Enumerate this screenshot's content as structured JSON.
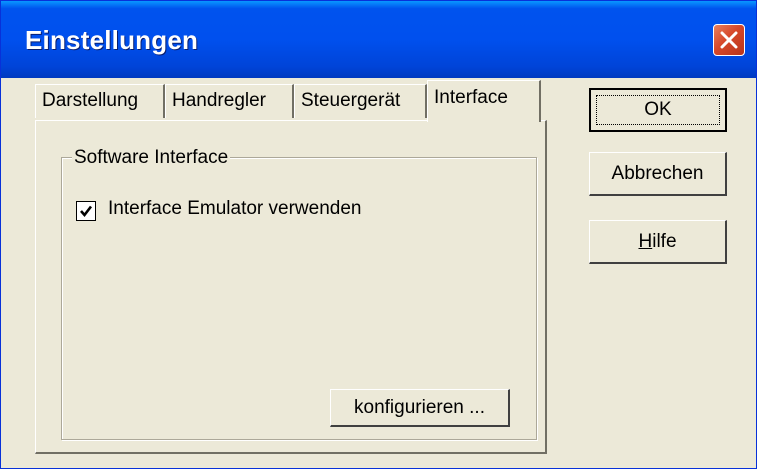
{
  "window": {
    "title": "Einstellungen"
  },
  "tabs": [
    {
      "label": "Darstellung"
    },
    {
      "label": "Handregler"
    },
    {
      "label": "Steuergerät"
    },
    {
      "label": "Interface",
      "active": true
    }
  ],
  "group": {
    "label": "Software Interface",
    "checkbox": {
      "label": "Interface Emulator verwenden",
      "checked": true
    }
  },
  "buttons": {
    "configure": "konfigurieren ...",
    "ok": "OK",
    "cancel": "Abbrechen",
    "help": {
      "mnemonic": "H",
      "rest": "ilfe"
    }
  },
  "icons": {
    "close": "close-icon",
    "check": "checkmark-icon"
  },
  "colors": {
    "titlebar": "#0050ee",
    "close_button": "#d6482a",
    "face": "#ece9d8"
  }
}
